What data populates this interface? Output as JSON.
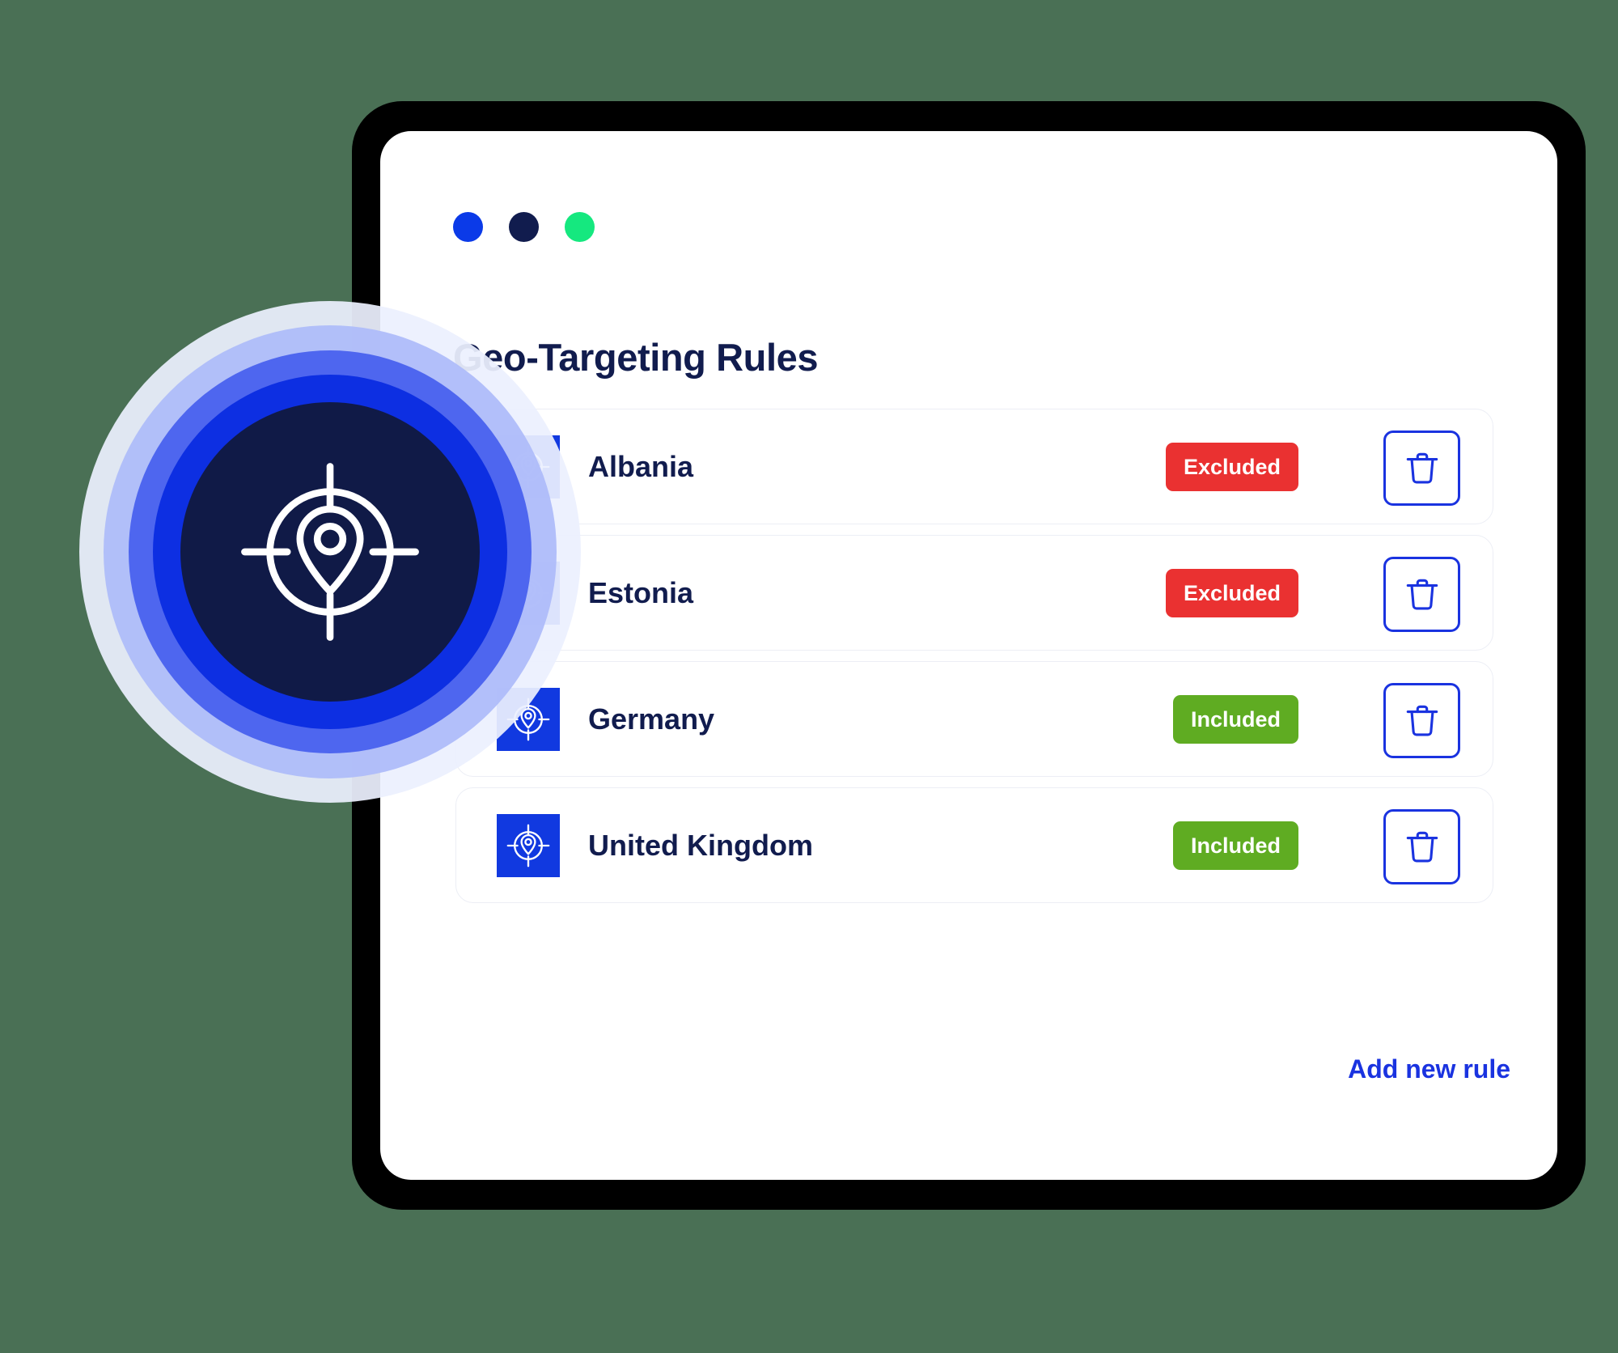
{
  "window": {
    "dots": [
      {
        "name": "dot-blue",
        "color": "#0b3ae8"
      },
      {
        "name": "dot-navy",
        "color": "#111c4e"
      },
      {
        "name": "dot-green",
        "color": "#15e87f"
      }
    ]
  },
  "header": {
    "title": "Geo-Targeting Rules"
  },
  "rules": [
    {
      "icon": "geo-target-icon",
      "country": "Albania",
      "status": "Excluded",
      "status_kind": "excluded",
      "delete_icon": "trash-icon"
    },
    {
      "icon": "geo-target-icon",
      "country": "Estonia",
      "status": "Excluded",
      "status_kind": "excluded",
      "delete_icon": "trash-icon"
    },
    {
      "icon": "geo-target-icon",
      "country": "Germany",
      "status": "Included",
      "status_kind": "included",
      "delete_icon": "trash-icon"
    },
    {
      "icon": "geo-target-icon",
      "country": "United Kingdom",
      "status": "Included",
      "status_kind": "included",
      "delete_icon": "trash-icon"
    }
  ],
  "footer": {
    "add_rule_label": "Add new rule"
  },
  "decoration": {
    "hero_icon": "geo-target-icon",
    "ring_colors": [
      "#ecf0fe",
      "#adbbfa",
      "#465fee",
      "#0a2ce0",
      "#101a47"
    ]
  },
  "colors": {
    "brand_blue": "#1139e0",
    "accent_link": "#1a33e0",
    "navy_text": "#111c4e",
    "badge_excluded": "#ea3131",
    "badge_included": "#5fac22",
    "page_background": "#4a7055",
    "window_bezel": "#000000",
    "panel": "#ffffff"
  }
}
